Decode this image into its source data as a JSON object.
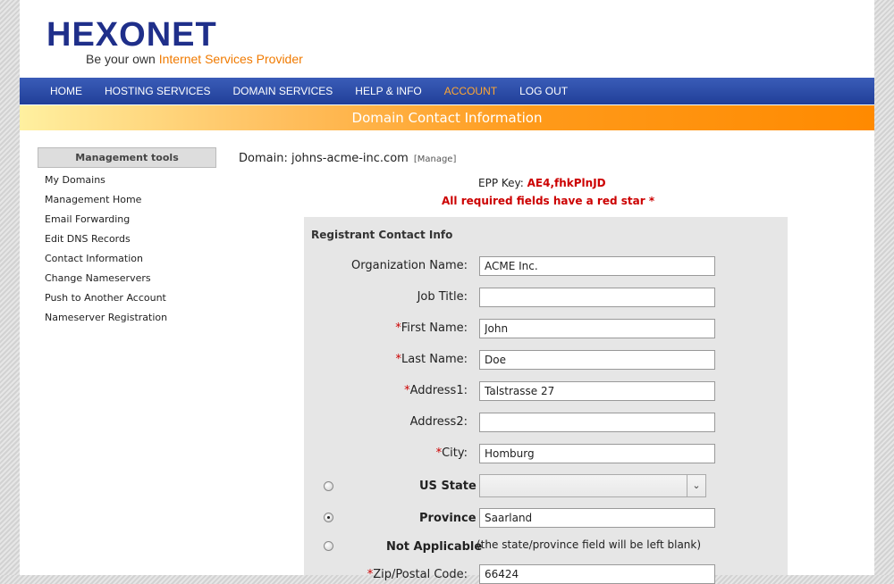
{
  "logo": {
    "brand": "HEXONET",
    "tagline_prefix": "Be your own ",
    "tagline_accent": "Internet Services Provider"
  },
  "nav": {
    "items": [
      {
        "label": "HOME"
      },
      {
        "label": "HOSTING SERVICES"
      },
      {
        "label": "DOMAIN SERVICES"
      },
      {
        "label": "HELP & INFO"
      },
      {
        "label": "ACCOUNT"
      },
      {
        "label": "LOG OUT"
      }
    ],
    "active": "ACCOUNT"
  },
  "banner": {
    "title": "Domain Contact Information"
  },
  "sidebar": {
    "header": "Management tools",
    "items": [
      {
        "label": "My Domains"
      },
      {
        "label": "Management Home"
      },
      {
        "label": "Email Forwarding"
      },
      {
        "label": "Edit DNS Records"
      },
      {
        "label": "Contact Information"
      },
      {
        "label": "Change Nameservers"
      },
      {
        "label": "Push to Another Account"
      },
      {
        "label": "Nameserver Registration"
      }
    ]
  },
  "domain": {
    "label": "Domain: johns-acme-inc.com",
    "manage": "[Manage]"
  },
  "epp": {
    "label": "EPP Key: ",
    "key": "AE4,fhkPlnJD"
  },
  "required_note": "All required fields have a red star *",
  "form": {
    "title": "Registrant Contact Info",
    "star": "*",
    "fields": {
      "organization": {
        "label": "Organization Name:",
        "value": "ACME Inc."
      },
      "job_title": {
        "label": "Job Title:",
        "value": ""
      },
      "first_name": {
        "label": "First Name:",
        "value": "John"
      },
      "last_name": {
        "label": "Last Name:",
        "value": "Doe"
      },
      "address1": {
        "label": "Address1:",
        "value": "Talstrasse 27"
      },
      "address2": {
        "label": "Address2:",
        "value": ""
      },
      "city": {
        "label": "City:",
        "value": "Homburg"
      },
      "zip": {
        "label": "Zip/Postal Code:",
        "value": "66424"
      }
    },
    "us_state": {
      "label": "US State",
      "selected": ""
    },
    "province": {
      "label": "Province",
      "value": "Saarland",
      "checked": true
    },
    "not_applicable": {
      "label": "Not Applicable",
      "note": "(the state/province field will be left blank)"
    }
  }
}
